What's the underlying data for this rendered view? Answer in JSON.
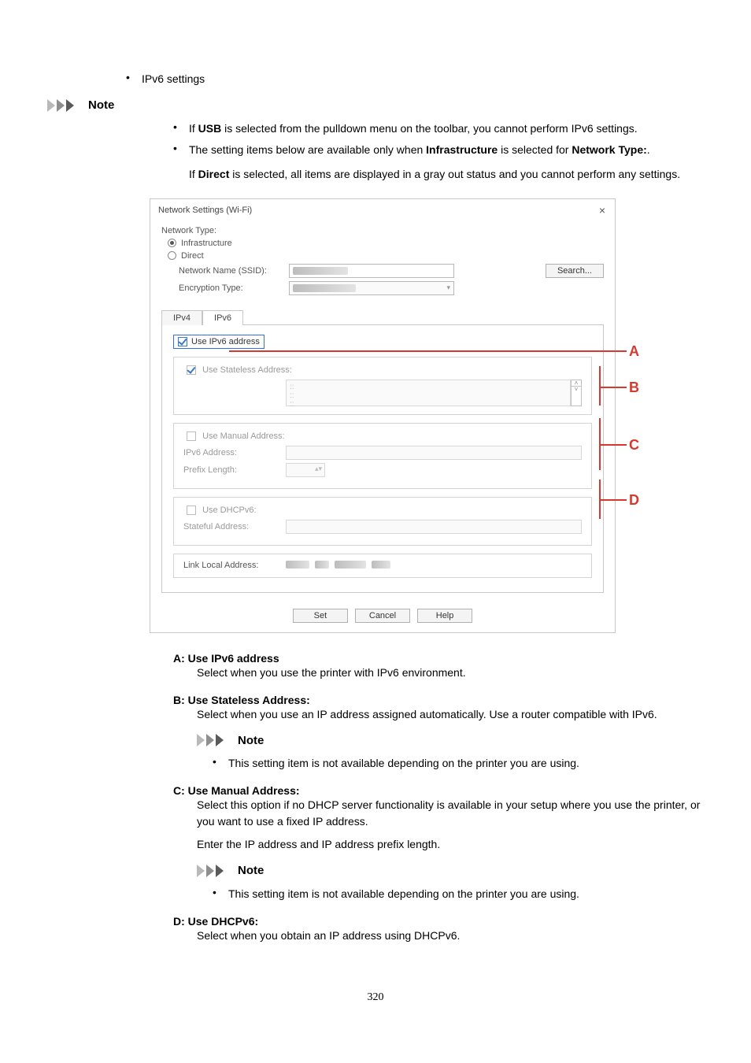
{
  "main_topic": "IPv6 settings",
  "note_label": "Note",
  "notes_top": [
    {
      "pre": "If ",
      "bold1": "USB",
      "post1": " is selected from the pulldown menu on the toolbar, you cannot perform IPv6 settings."
    },
    {
      "pre": "The setting items below are available only when ",
      "bold1": "Infrastructure",
      "mid": " is selected for ",
      "bold2": "Network Type:",
      "post": "."
    }
  ],
  "notes_top_para": {
    "pre": "If ",
    "bold1": "Direct",
    "post": " is selected, all items are displayed in a gray out status and you cannot perform any settings."
  },
  "dialog": {
    "title": "Network Settings (Wi-Fi)",
    "labels": {
      "network_type": "Network Type:",
      "infrastructure": "Infrastructure",
      "direct": "Direct",
      "ssid": "Network Name (SSID):",
      "encryption": "Encryption Type:",
      "search": "Search...",
      "tab_ipv4": "IPv4",
      "tab_ipv6": "IPv6",
      "use_ipv6": "Use IPv6 address",
      "use_stateless": "Use Stateless Address:",
      "use_manual": "Use Manual Address:",
      "ipv6_address": "IPv6 Address:",
      "prefix_length": "Prefix Length:",
      "use_dhcpv6": "Use DHCPv6:",
      "stateful_address": "Stateful Address:",
      "link_local": "Link Local Address:",
      "set": "Set",
      "cancel": "Cancel",
      "help": "Help"
    },
    "callouts": {
      "a": "A",
      "b": "B",
      "c": "C",
      "d": "D"
    }
  },
  "definitions": {
    "a": {
      "term": "A: Use IPv6 address",
      "body": "Select when you use the printer with IPv6 environment."
    },
    "b": {
      "term": "B: Use Stateless Address:",
      "body": "Select when you use an IP address assigned automatically. Use a router compatible with IPv6.",
      "note": "This setting item is not available depending on the printer you are using."
    },
    "c": {
      "term": "C: Use Manual Address:",
      "body1": "Select this option if no DHCP server functionality is available in your setup where you use the printer, or you want to use a fixed IP address.",
      "body2": "Enter the IP address and IP address prefix length.",
      "note": "This setting item is not available depending on the printer you are using."
    },
    "d": {
      "term": "D: Use DHCPv6:",
      "body": "Select when you obtain an IP address using DHCPv6."
    }
  },
  "page_number": "320"
}
